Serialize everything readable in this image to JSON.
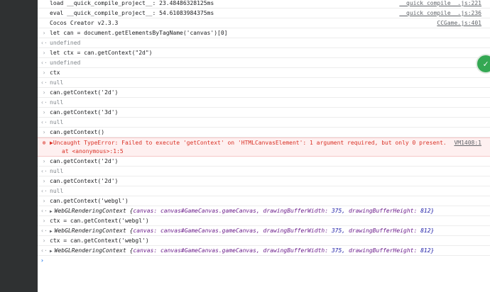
{
  "console": {
    "lines": [
      {
        "kind": "log",
        "text": "load __quick_compile_project__: 23.48486328125ms",
        "src": "__quick_compile__.js:221"
      },
      {
        "kind": "log",
        "text": "eval __quick_compile_project__: 54.61083984375ms",
        "src": "__quick_compile__.js:236"
      },
      {
        "kind": "log",
        "text": "Cocos Creator v2.3.3",
        "src": "CCGame.js:401"
      },
      {
        "kind": "input",
        "text": "let can = document.getElementsByTagName('canvas')[0]"
      },
      {
        "kind": "result",
        "text": "undefined"
      },
      {
        "kind": "input",
        "text": "let ctx = can.getContext(\"2d\")"
      },
      {
        "kind": "result",
        "text": "undefined"
      },
      {
        "kind": "input",
        "text": "ctx"
      },
      {
        "kind": "result",
        "text": "null"
      },
      {
        "kind": "input",
        "text": "can.getContext('2d')"
      },
      {
        "kind": "result",
        "text": "null"
      },
      {
        "kind": "input",
        "text": "can.getContext('3d')"
      },
      {
        "kind": "result",
        "text": "null"
      },
      {
        "kind": "input",
        "text": "can.getContext()"
      },
      {
        "kind": "error",
        "text": "▶Uncaught TypeError: Failed to execute 'getContext' on 'HTMLCanvasElement': 1 argument required, but only 0 present.",
        "text2": "at <anonymous>:1:5",
        "src": "VM1408:1"
      },
      {
        "kind": "input",
        "text": "can.getContext('2d')"
      },
      {
        "kind": "result",
        "text": "null"
      },
      {
        "kind": "input",
        "text": "can.getContext('2d')"
      },
      {
        "kind": "result",
        "text": "null"
      },
      {
        "kind": "input",
        "text": "can.getContext('webgl')"
      },
      {
        "kind": "object",
        "name": "WebGLRenderingContext",
        "canvas_key": "canvas:",
        "canvas_val": "canvas#GameCanvas.gameCanvas,",
        "w_key": "drawingBufferWidth:",
        "w_val": "375,",
        "h_key": "drawingBufferHeight:",
        "h_val": "812}",
        "open": "{"
      },
      {
        "kind": "input",
        "text": "ctx = can.getContext('webgl')"
      },
      {
        "kind": "object",
        "name": "WebGLRenderingContext",
        "canvas_key": "canvas:",
        "canvas_val": "canvas#GameCanvas.gameCanvas,",
        "w_key": "drawingBufferWidth:",
        "w_val": "375,",
        "h_key": "drawingBufferHeight:",
        "h_val": "812}",
        "open": "{"
      },
      {
        "kind": "input",
        "text": "ctx = can.getContext('webgl')"
      },
      {
        "kind": "object",
        "name": "WebGLRenderingContext",
        "canvas_key": "canvas:",
        "canvas_val": "canvas#GameCanvas.gameCanvas,",
        "w_key": "drawingBufferWidth:",
        "w_val": "375,",
        "h_key": "drawingBufferHeight:",
        "h_val": "812}",
        "open": "{"
      }
    ],
    "prompt_symbol": "›",
    "input_symbol": "›",
    "result_symbol": "‹·",
    "error_symbol": "⊗",
    "colors": {
      "error": "#d93025",
      "prompt": "#1a73e8",
      "error_bg": "#fef0f0"
    }
  }
}
